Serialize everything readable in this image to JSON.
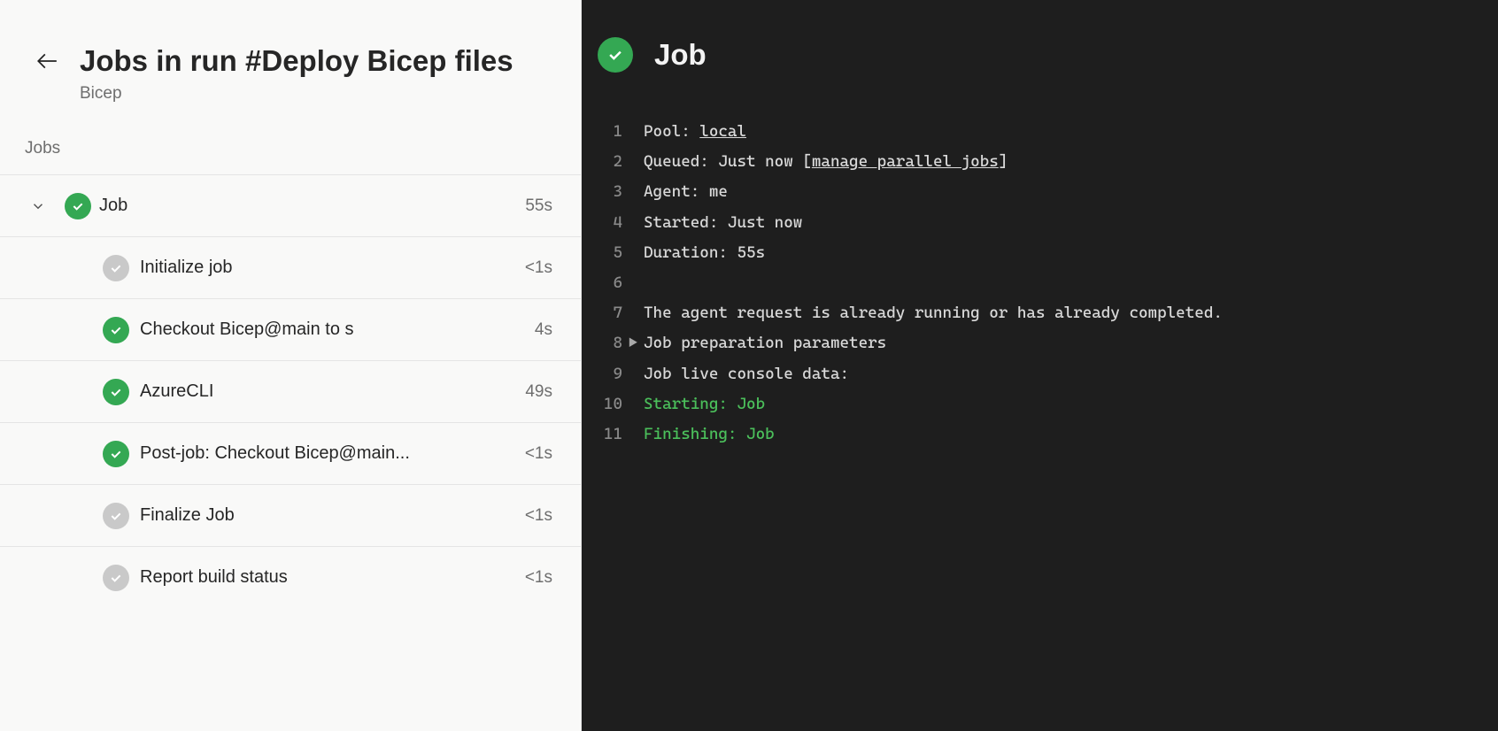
{
  "header": {
    "title": "Jobs in run #Deploy Bicep files",
    "subtitle": "Bicep"
  },
  "section_label": "Jobs",
  "job": {
    "name": "Job",
    "duration": "55s",
    "status": "green"
  },
  "steps": [
    {
      "name": "Initialize job",
      "duration": "<1s",
      "status": "gray"
    },
    {
      "name": "Checkout Bicep@main to s",
      "duration": "4s",
      "status": "green"
    },
    {
      "name": "AzureCLI",
      "duration": "49s",
      "status": "green"
    },
    {
      "name": "Post-job: Checkout Bicep@main...",
      "duration": "<1s",
      "status": "green"
    },
    {
      "name": "Finalize Job",
      "duration": "<1s",
      "status": "gray"
    },
    {
      "name": "Report build status",
      "duration": "<1s",
      "status": "gray"
    }
  ],
  "details": {
    "title": "Job",
    "status": "green"
  },
  "log": [
    {
      "n": "1",
      "t": "plain",
      "prefix": "Pool: ",
      "link": "local"
    },
    {
      "n": "2",
      "t": "plain",
      "prefix": "Queued: Just now [",
      "link": "manage parallel jobs",
      "suffix": "]"
    },
    {
      "n": "3",
      "t": "text",
      "text": "Agent: me"
    },
    {
      "n": "4",
      "t": "text",
      "text": "Started: Just now"
    },
    {
      "n": "5",
      "t": "text",
      "text": "Duration: 55s"
    },
    {
      "n": "6",
      "t": "text",
      "text": ""
    },
    {
      "n": "7",
      "t": "text",
      "text": "The agent request is already running or has already completed."
    },
    {
      "n": "8",
      "t": "fold",
      "text": "Job preparation parameters"
    },
    {
      "n": "9",
      "t": "text",
      "text": "Job live console data:"
    },
    {
      "n": "10",
      "t": "green",
      "text": "Starting: Job"
    },
    {
      "n": "11",
      "t": "green",
      "text": "Finishing: Job"
    }
  ]
}
